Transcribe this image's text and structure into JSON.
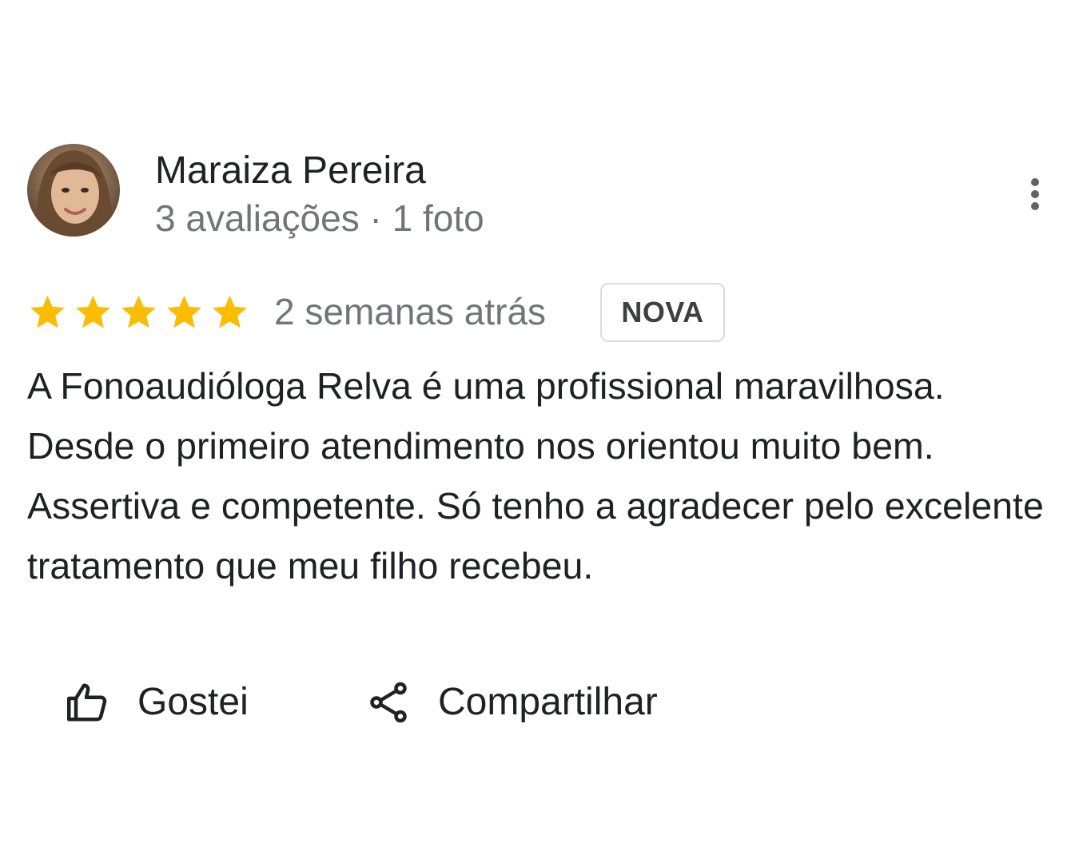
{
  "review": {
    "author": {
      "name": "Maraiza Pereira",
      "meta": "3 avaliações · 1 foto",
      "avatar_icon": "user-avatar-photo"
    },
    "more_options_icon": "more-vert-icon",
    "rating": {
      "stars": 5,
      "max_stars": 5,
      "star_color": "#fbbc04"
    },
    "date": "2 semanas atrás",
    "badge": "NOVA",
    "text": "A Fonoaudióloga Relva é uma profissional maravilhosa. Desde o primeiro atendimento nos orientou muito bem. Assertiva e competente. Só tenho a agradecer pelo excelente tratamento que meu filho recebeu.",
    "actions": {
      "like_label": "Gostei",
      "like_icon": "thumb-up-icon",
      "share_label": "Compartilhar",
      "share_icon": "share-icon"
    }
  }
}
